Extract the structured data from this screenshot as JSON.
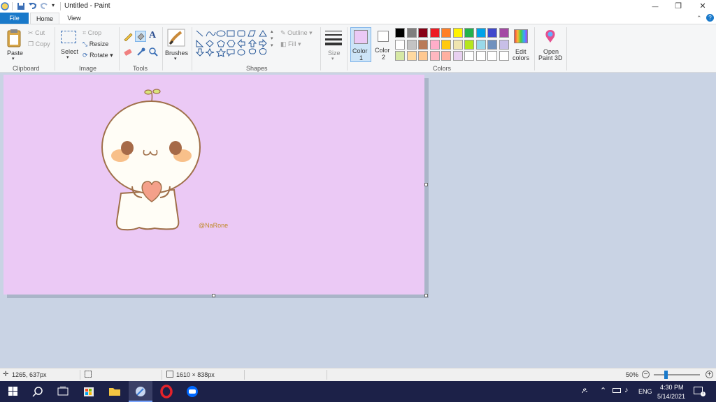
{
  "titlebar": {
    "title": "Untitled - Paint",
    "minimize": "—",
    "restore": "❐",
    "close": "✕"
  },
  "tabs": {
    "file": "File",
    "home": "Home",
    "view": "View"
  },
  "ribbon": {
    "clipboard": {
      "paste": "Paste",
      "cut": "Cut",
      "copy": "Copy",
      "label": "Clipboard"
    },
    "image": {
      "select": "Select",
      "crop": "Crop",
      "resize": "Resize",
      "rotate": "Rotate",
      "label": "Image"
    },
    "tools": {
      "label": "Tools"
    },
    "brushes": {
      "label": "Brushes"
    },
    "shapes": {
      "outline": "Outline",
      "fill": "Fill",
      "label": "Shapes"
    },
    "size": {
      "label": "Size"
    },
    "colors": {
      "color1": "Color",
      "color1_num": "1",
      "color2": "Color",
      "color2_num": "2",
      "edit": "Edit",
      "edit2": "colors",
      "paint3d": "Open",
      "paint3d2": "Paint 3D",
      "label": "Colors",
      "color1_value": "#ebc9f5",
      "color2_value": "#ffffff",
      "palette_row1": [
        "#000000",
        "#7f7f7f",
        "#880015",
        "#ed1c24",
        "#ff7f27",
        "#fff200",
        "#22b14c",
        "#00a2e8",
        "#3f48cc",
        "#a349a4"
      ],
      "palette_row2": [
        "#ffffff",
        "#c3c3c3",
        "#b97a57",
        "#ffaec9",
        "#ffc90e",
        "#efe4b0",
        "#b5e61d",
        "#99d9ea",
        "#7092be",
        "#c8bfe7"
      ],
      "palette_row3": [
        "#d6e8a4",
        "#ffd9a0",
        "#ffc890",
        "#ffb8c0",
        "#ffb0a0",
        "#e8d0f0",
        "#ffffff",
        "#ffffff",
        "#ffffff",
        "#ffffff"
      ]
    }
  },
  "canvas": {
    "background": "#ebc9f5",
    "signature": "@NaRone"
  },
  "status": {
    "cursor": "1265, 637px",
    "dimensions": "1610 × 838px",
    "zoom": "50%",
    "zoom_level": 0.5
  },
  "taskbar": {
    "lang": "ENG",
    "time": "4:30 PM",
    "date": "5/14/2021"
  }
}
